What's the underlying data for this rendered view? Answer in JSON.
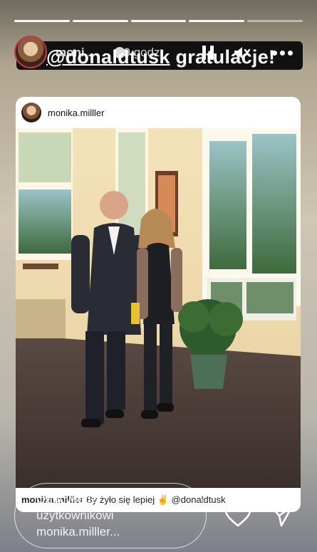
{
  "story": {
    "progress_segments": 5,
    "active_segment": 4
  },
  "header": {
    "username": "moni...",
    "time": "9 godz.",
    "sticker_mention": "@donaldtusk",
    "sticker_text": "gratulacje!"
  },
  "post": {
    "username": "monika.milller",
    "caption_user": "monika.milller",
    "caption_text": "By żyło się lepiej ✌️ @donaldtusk"
  },
  "reply": {
    "placeholder": "Odpowiedz użytkownikowi monika.milller..."
  },
  "icons": {
    "pause": "pause-icon",
    "mute": "mute-icon",
    "more": "more-icon",
    "like": "heart-icon",
    "share": "send-icon"
  },
  "colors": {
    "ring": "#c23a4b",
    "sticker_bg": "#111111"
  }
}
